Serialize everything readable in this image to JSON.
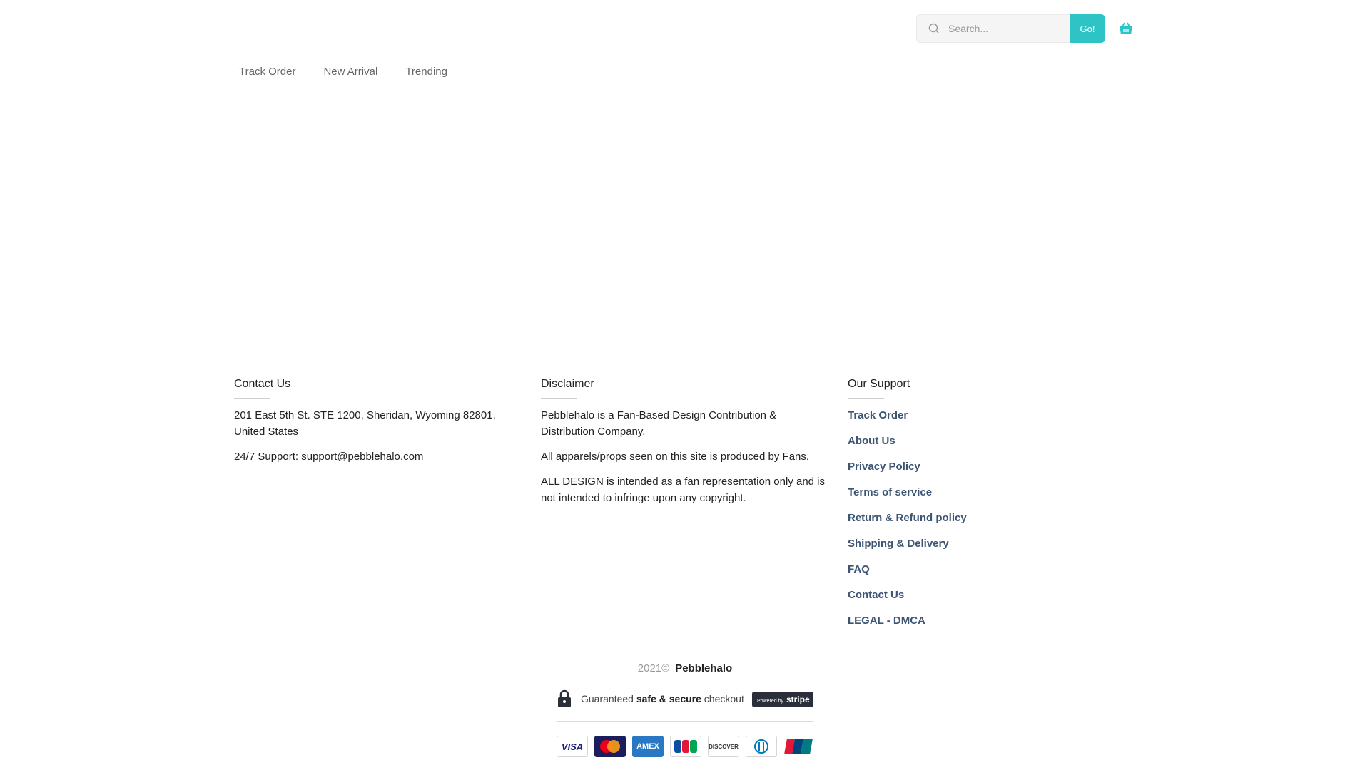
{
  "header": {
    "search_placeholder": "Search...",
    "go_label": "Go!"
  },
  "nav": {
    "items": [
      {
        "label": "Track Order"
      },
      {
        "label": "New Arrival"
      },
      {
        "label": "Trending"
      }
    ]
  },
  "footer": {
    "contact": {
      "title": "Contact Us",
      "address": "201 East 5th St. STE 1200, Sheridan, Wyoming 82801, United States",
      "support": "24/7 Support: support@pebblehalo.com"
    },
    "disclaimer": {
      "title": "Disclaimer",
      "paragraphs": [
        "Pebblehalo is a Fan-Based Design Contribution & Distribution Company.",
        "All apparels/props seen on this site is produced by Fans.",
        "ALL DESIGN is intended as a fan representation only and is not intended to infringe upon any copyright."
      ]
    },
    "support": {
      "title": "Our Support",
      "links": [
        "Track Order",
        "About Us",
        "Privacy Policy",
        "Terms of service",
        "Return & Refund policy",
        "Shipping & Delivery",
        "FAQ",
        "Contact Us",
        "LEGAL - DMCA"
      ]
    },
    "copyright_year": "2021©",
    "brand": "Pebblehalo",
    "secure_text_prefix": "Guaranteed",
    "secure_text_bold": "safe & secure",
    "secure_text_suffix": "checkout",
    "stripe_prefix": "Powered by",
    "stripe_name": "stripe",
    "payments": {
      "visa": "VISA",
      "amex": "AMEX",
      "discover": "DISCOVER"
    }
  },
  "colors": {
    "accent": "#2ec4c5",
    "link": "#3d5573"
  },
  "icons": {
    "search": "search-icon",
    "cart": "basket-icon",
    "lock": "lock-icon"
  }
}
